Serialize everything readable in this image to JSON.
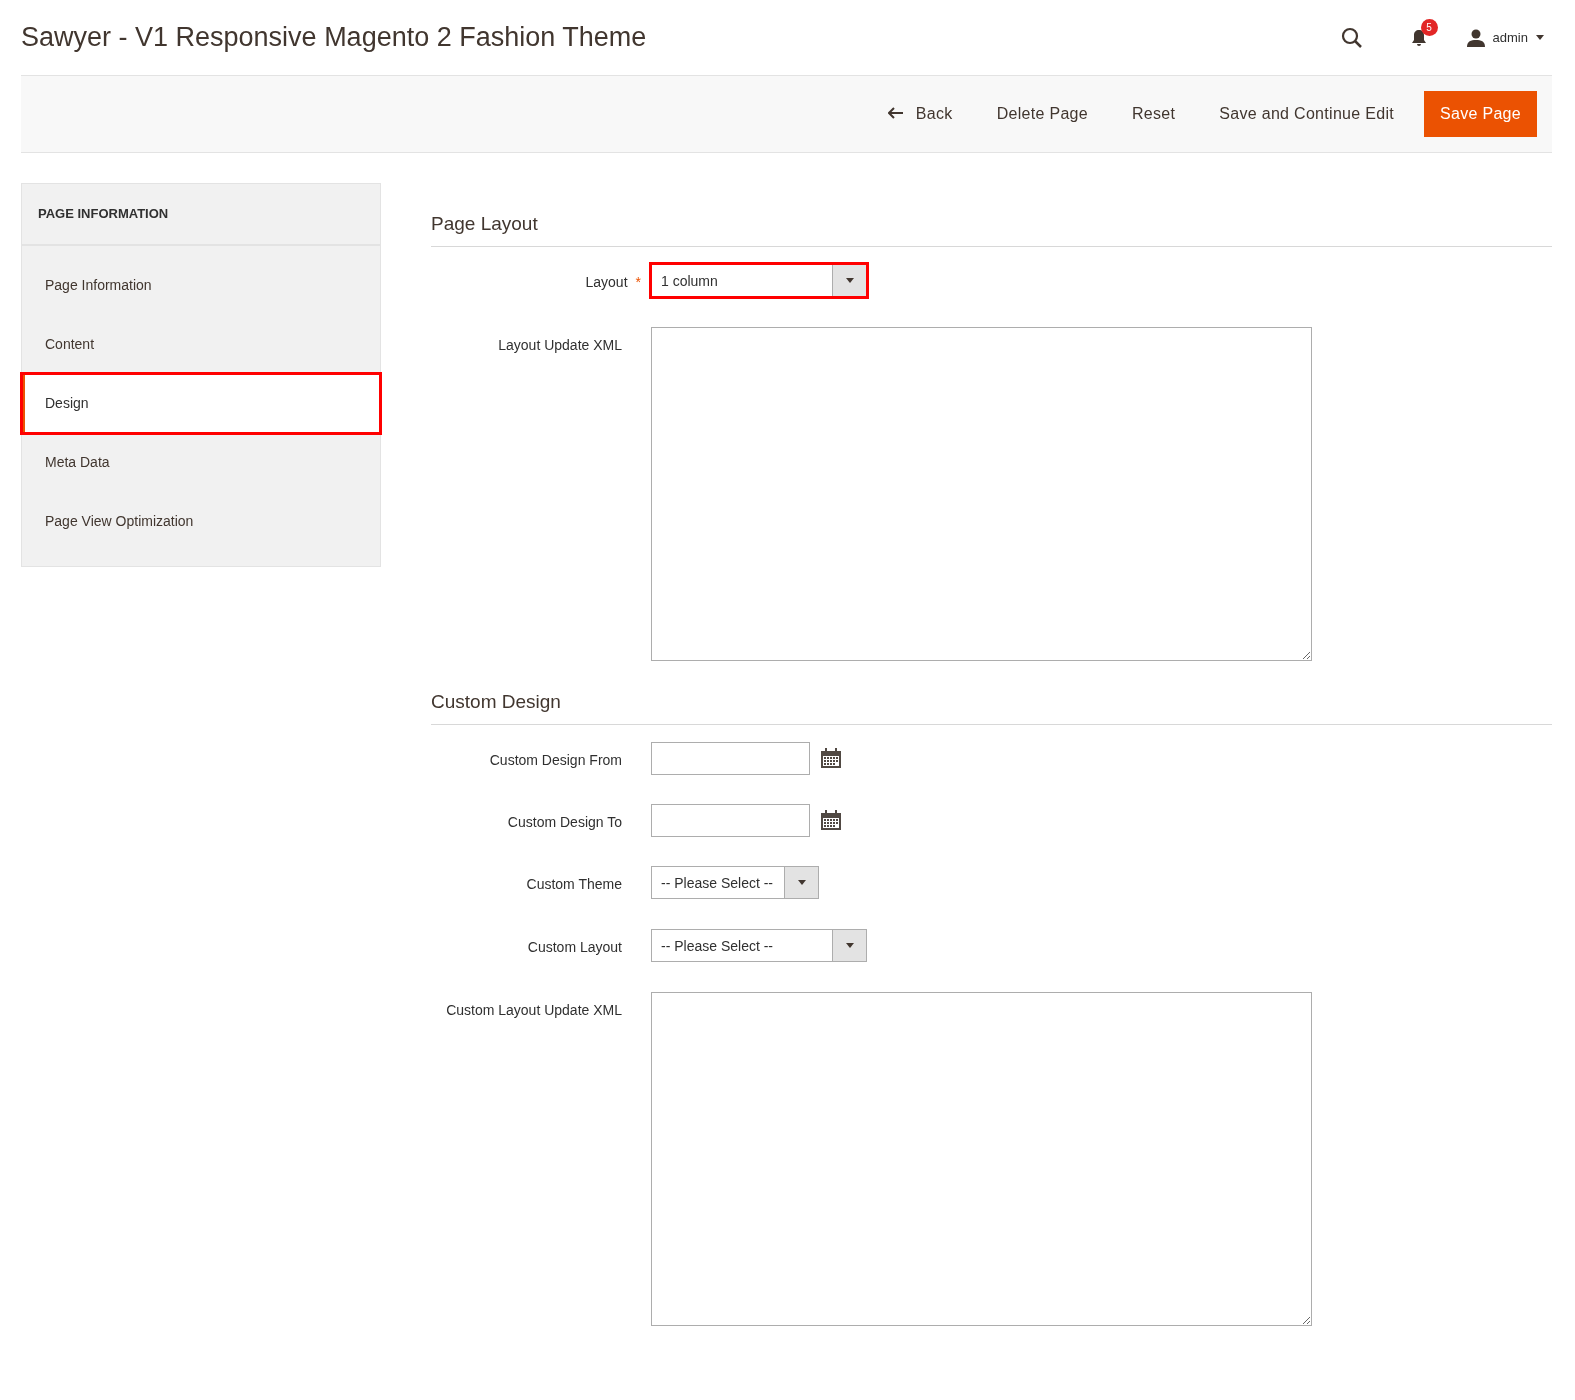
{
  "page_title": "Sawyer - V1 Responsive Magento 2 Fashion Theme",
  "header": {
    "notification_count": "5",
    "user": "admin"
  },
  "actions": [
    {
      "label": "Back",
      "kind": "back"
    },
    {
      "label": "Delete Page",
      "kind": "plain"
    },
    {
      "label": "Reset",
      "kind": "plain"
    },
    {
      "label": "Save and Continue Edit",
      "kind": "plain"
    },
    {
      "label": "Save Page",
      "kind": "primary"
    }
  ],
  "sidebar": {
    "title": "PAGE INFORMATION",
    "items": [
      {
        "label": "Page Information",
        "selected": false,
        "highlighted": false
      },
      {
        "label": "Content",
        "selected": false,
        "highlighted": false
      },
      {
        "label": "Design",
        "selected": true,
        "highlighted": true
      },
      {
        "label": "Meta Data",
        "selected": false,
        "highlighted": false
      },
      {
        "label": "Page View Optimization",
        "selected": false,
        "highlighted": false
      }
    ]
  },
  "sections": [
    {
      "title": "Page Layout",
      "fields": [
        {
          "label": "Layout",
          "kind": "select",
          "required_mark": "*",
          "value": "1 column",
          "wide": true,
          "highlighted": true
        },
        {
          "label": "Layout Update XML",
          "kind": "textarea",
          "highlighted": false
        }
      ]
    },
    {
      "title": "Custom Design",
      "fields": [
        {
          "label": "Custom Design From",
          "kind": "date",
          "highlighted": false
        },
        {
          "label": "Custom Design To",
          "kind": "date",
          "highlighted": false
        },
        {
          "label": "Custom Theme",
          "kind": "select",
          "value": "-- Please Select --",
          "wide": false,
          "highlighted": false
        },
        {
          "label": "Custom Layout",
          "kind": "select",
          "value": "-- Please Select --",
          "wide": true,
          "highlighted": false
        },
        {
          "label": "Custom Layout Update XML",
          "kind": "textarea",
          "highlighted": false
        }
      ]
    }
  ]
}
